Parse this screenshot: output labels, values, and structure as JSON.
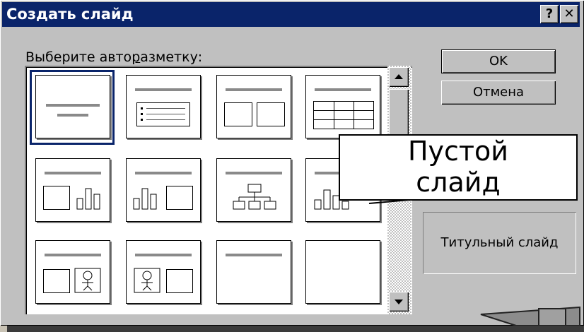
{
  "dialog": {
    "title": "Создать слайд",
    "help_button": "?",
    "close_button": "✕",
    "prompt_prefix": "Выберите авто",
    "prompt_underlined": "р",
    "prompt_suffix": "азметку:"
  },
  "buttons": {
    "ok": "OK",
    "cancel": "Отмена"
  },
  "preview_label": "Титульный слайд",
  "tooltip": {
    "line1": "Пустой",
    "line2": "слайд"
  },
  "colors": {
    "titlebar": "#0a246a",
    "face": "#c0c0c0"
  }
}
